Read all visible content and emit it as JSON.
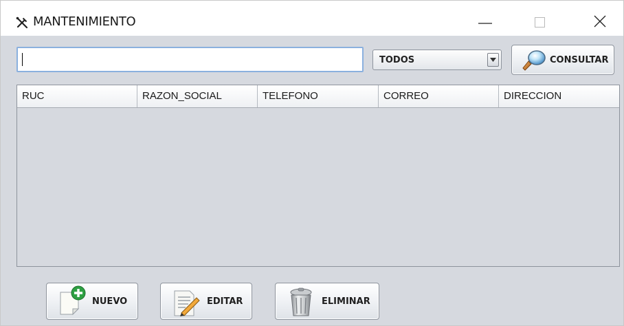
{
  "window": {
    "title": "MANTENIMIENTO",
    "icon": "tools-icon"
  },
  "search": {
    "value": "",
    "placeholder": ""
  },
  "filter": {
    "selected": "TODOS"
  },
  "buttons": {
    "consultar": "CONSULTAR",
    "nuevo": "NUEVO",
    "editar": "EDITAR",
    "eliminar": "ELIMINAR"
  },
  "table": {
    "columns": [
      "RUC",
      "RAZON_SOCIAL",
      "TELEFONO",
      "CORREO",
      "DIRECCION"
    ],
    "rows": []
  },
  "icons": {
    "consultar": "magnifier-icon",
    "nuevo": "new-document-icon",
    "editar": "edit-document-icon",
    "eliminar": "trash-can-icon"
  },
  "colors": {
    "background": "#d6d9df",
    "input_border": "#8ab0de",
    "add_green": "#2ea043"
  }
}
